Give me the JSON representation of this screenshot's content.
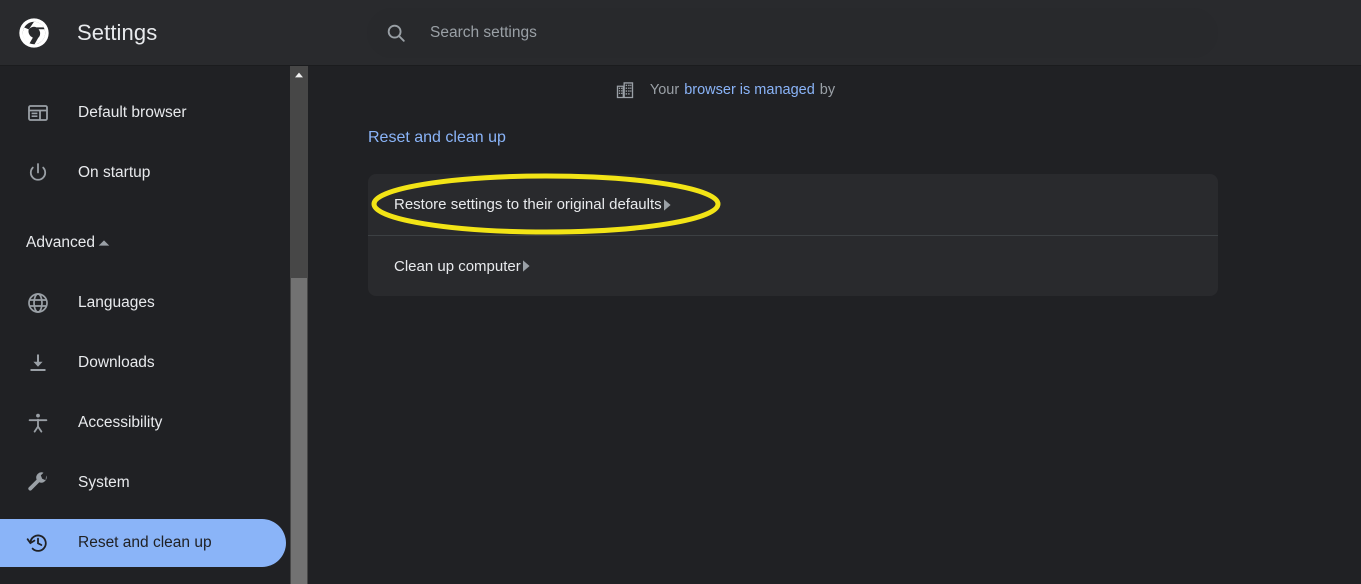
{
  "header": {
    "logo_icon": "chrome-logo-icon",
    "title": "Settings",
    "search": {
      "icon": "search-icon",
      "placeholder": "Search settings",
      "value": ""
    }
  },
  "sidebar": {
    "items": [
      {
        "label": "Default browser",
        "icon": "browser-window-icon",
        "selected": false
      },
      {
        "label": "On startup",
        "icon": "power-icon",
        "selected": false
      }
    ],
    "advanced_section": {
      "label": "Advanced",
      "expanded": true,
      "chevron_icon": "chevron-up-icon"
    },
    "advanced_items": [
      {
        "label": "Languages",
        "icon": "globe-icon",
        "selected": false
      },
      {
        "label": "Downloads",
        "icon": "download-icon",
        "selected": false
      },
      {
        "label": "Accessibility",
        "icon": "accessibility-icon",
        "selected": false
      },
      {
        "label": "System",
        "icon": "wrench-icon",
        "selected": false
      },
      {
        "label": "Reset and clean up",
        "icon": "history-restore-icon",
        "selected": true
      }
    ],
    "scrollbar": {
      "up_button_icon": "scroll-up-arrow-icon"
    }
  },
  "main": {
    "managed_banner": {
      "icon": "building-icon",
      "prefix": "Your",
      "link_text": "browser is managed",
      "suffix": "by",
      "organization": ""
    },
    "section_title": "Reset and clean up",
    "rows": [
      {
        "label": "Restore settings to their original defaults",
        "arrow_icon": "arrow-right-icon"
      },
      {
        "label": "Clean up computer",
        "arrow_icon": "arrow-right-icon"
      }
    ]
  },
  "annotation": {
    "shape": "ellipse-highlight",
    "color": "#F2E416",
    "targets": "Restore settings to their original defaults"
  },
  "colors": {
    "page_background": "#202124",
    "header_background": "#292A2D",
    "card_background": "#292A2D",
    "accent_blue": "#8AB4F8",
    "text_primary": "#E8EAED",
    "text_secondary": "#9AA0A6",
    "divider": "#3C4043",
    "annotation_yellow": "#F2E416"
  }
}
